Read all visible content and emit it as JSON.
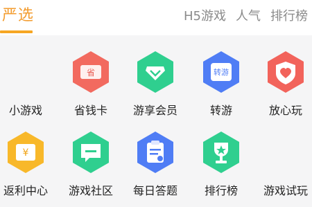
{
  "header": {
    "active_tab": "严选",
    "tabs": [
      "H5游戏",
      "人气",
      "排行榜"
    ]
  },
  "grid": {
    "row1": [
      {
        "label": "小游戏",
        "icon": "",
        "color": ""
      },
      {
        "label": "省钱卡",
        "icon": "coupon-icon",
        "color": "#f26a5f",
        "glyph": "省"
      },
      {
        "label": "游享会员",
        "icon": "diamond-icon",
        "color": "#2fcf8f"
      },
      {
        "label": "转游",
        "icon": "transfer-icon",
        "color": "#4f7df5",
        "glyph": "转游"
      },
      {
        "label": "放心玩",
        "icon": "heart-shield-icon",
        "color": "#f2635b"
      }
    ],
    "row2": [
      {
        "label": "返利中心",
        "icon": "yen-coupon-icon",
        "color": "#f8b82a",
        "glyph": "¥"
      },
      {
        "label": "游戏社区",
        "icon": "chat-icon",
        "color": "#2fcf8f"
      },
      {
        "label": "每日答题",
        "icon": "clipboard-icon",
        "color": "#4f7df5"
      },
      {
        "label": "排行榜",
        "icon": "trophy-icon",
        "color": "#2fcf8f"
      },
      {
        "label": "游戏试玩",
        "icon": "",
        "color": ""
      }
    ]
  }
}
